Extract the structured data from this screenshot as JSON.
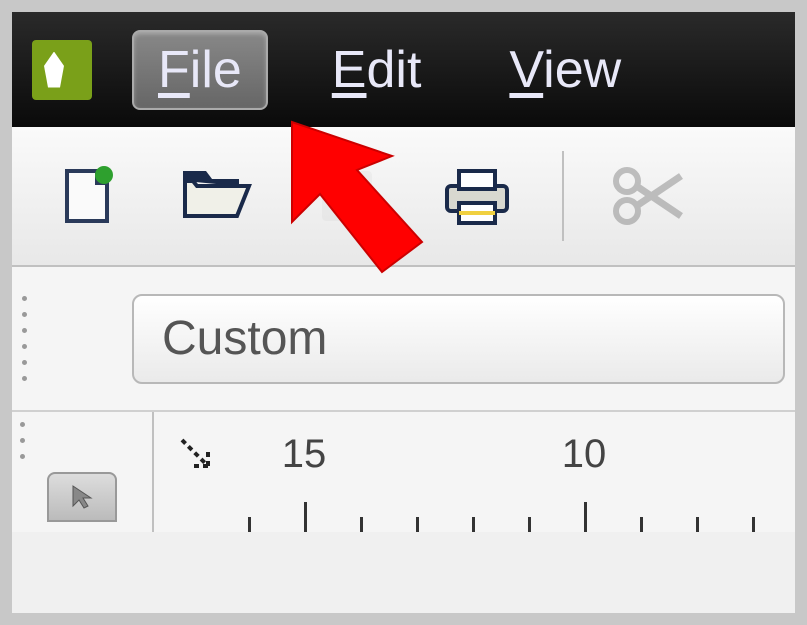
{
  "menu": {
    "items": [
      {
        "label": "File",
        "mnemonic": "F",
        "highlighted": true
      },
      {
        "label": "Edit",
        "mnemonic": "E",
        "highlighted": false
      },
      {
        "label": "View",
        "mnemonic": "V",
        "highlighted": false
      }
    ]
  },
  "toolbar": {
    "new_doc": "new-document",
    "open": "open-folder",
    "save": "save",
    "print": "print",
    "cut": "cut"
  },
  "dropdown": {
    "selected": "Custom"
  },
  "ruler": {
    "labels": [
      "15",
      "10"
    ],
    "positions": [
      150,
      430
    ]
  },
  "annotation": {
    "cursor_points_to": "File menu"
  }
}
